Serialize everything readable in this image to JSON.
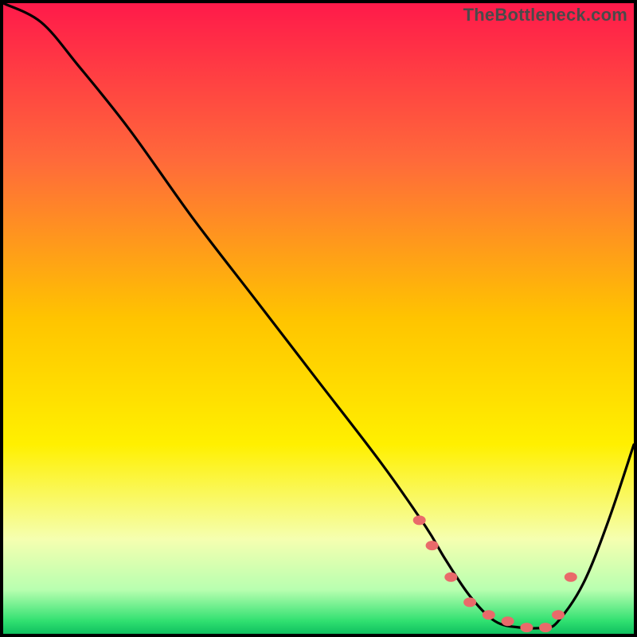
{
  "watermark": "TheBottleneck.com",
  "chart_data": {
    "type": "line",
    "title": "",
    "xlabel": "",
    "ylabel": "",
    "ylim": [
      0,
      100
    ],
    "xlim": [
      0,
      100
    ],
    "series": [
      {
        "name": "bottleneck-curve",
        "x": [
          0,
          6,
          12,
          20,
          30,
          40,
          50,
          60,
          67,
          70,
          74,
          78,
          82,
          86,
          88,
          92,
          96,
          100
        ],
        "values": [
          100,
          97,
          90,
          80,
          66,
          53,
          40,
          27,
          17,
          12,
          6,
          2,
          1,
          1,
          2,
          8,
          18,
          30
        ]
      }
    ],
    "markers": {
      "name": "highlight-points",
      "color": "#e96a6a",
      "x": [
        66,
        68,
        71,
        74,
        77,
        80,
        83,
        86,
        88,
        90
      ],
      "values": [
        18,
        14,
        9,
        5,
        3,
        2,
        1,
        1,
        3,
        9
      ]
    },
    "gradient_stops": [
      {
        "offset": 0,
        "color": "#ff1a4a"
      },
      {
        "offset": 0.25,
        "color": "#ff6a3a"
      },
      {
        "offset": 0.5,
        "color": "#ffc400"
      },
      {
        "offset": 0.7,
        "color": "#fff000"
      },
      {
        "offset": 0.85,
        "color": "#f5ffb0"
      },
      {
        "offset": 0.93,
        "color": "#b8ffb0"
      },
      {
        "offset": 0.98,
        "color": "#30e070"
      },
      {
        "offset": 1.0,
        "color": "#10c060"
      }
    ]
  }
}
